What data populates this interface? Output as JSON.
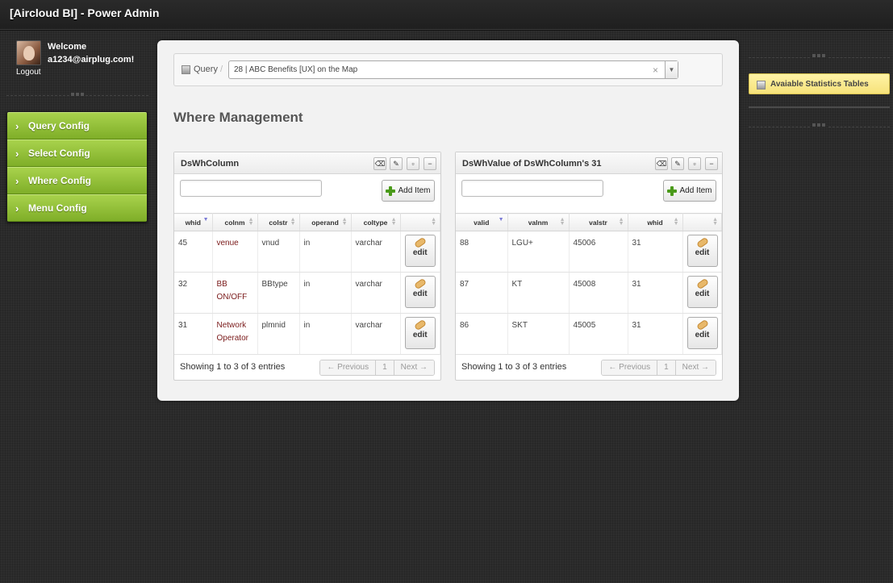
{
  "header": {
    "title": "[Aircloud BI] - Power Admin"
  },
  "user": {
    "welcome": "Welcome",
    "email": "a1234@airplug.com!",
    "logout": "Logout"
  },
  "menu": {
    "items": [
      {
        "label": "Query Config"
      },
      {
        "label": "Select Config"
      },
      {
        "label": "Where Config"
      },
      {
        "label": "Menu Config"
      }
    ]
  },
  "query": {
    "label": "Query",
    "separator": "/",
    "selected": "28 | ABC Benefits [UX] on the Map",
    "clear": "×",
    "arrow": "▼"
  },
  "page": {
    "heading": "Where Management"
  },
  "panel_left": {
    "title": "DsWhColumn",
    "add_label": "Add Item",
    "columns": [
      "whid",
      "colnm",
      "colstr",
      "operand",
      "coltype",
      ""
    ],
    "rows": [
      {
        "whid": "45",
        "colnm": "venue",
        "colstr": "vnud",
        "operand": "in",
        "coltype": "varchar"
      },
      {
        "whid": "32",
        "colnm": "BB ON/OFF",
        "colstr": "BBtype",
        "operand": "in",
        "coltype": "varchar"
      },
      {
        "whid": "31",
        "colnm": "Network Operator",
        "colstr": "plmnid",
        "operand": "in",
        "coltype": "varchar"
      }
    ],
    "edit_label": "edit",
    "info": "Showing 1 to 3 of 3 entries",
    "pager": {
      "prev": "← Previous",
      "page": "1",
      "next": "Next →"
    }
  },
  "panel_right": {
    "title": "DsWhValue of DsWhColumn's 31",
    "add_label": "Add Item",
    "columns": [
      "valid",
      "valnm",
      "valstr",
      "whid",
      ""
    ],
    "rows": [
      {
        "valid": "88",
        "valnm": "LGU+",
        "valstr": "45006",
        "whid": "31"
      },
      {
        "valid": "87",
        "valnm": "KT",
        "valstr": "45008",
        "whid": "31"
      },
      {
        "valid": "86",
        "valnm": "SKT",
        "valstr": "45005",
        "whid": "31"
      }
    ],
    "edit_label": "edit",
    "info": "Showing 1 to 3 of 3 entries",
    "pager": {
      "prev": "← Previous",
      "page": "1",
      "next": "Next →"
    }
  },
  "right_sidebar": {
    "stats_label": "Avaiable Statistics Tables"
  },
  "colors": {
    "menu_green": "#8fbf35",
    "stats_yellow": "#f9e88d",
    "link_red": "#7a1a1a"
  }
}
